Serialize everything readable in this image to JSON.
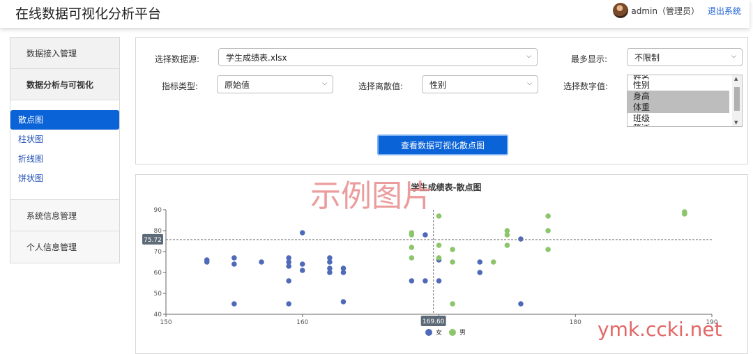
{
  "header": {
    "title": "在线数据可视化分析平台",
    "user_name": "admin（管理员）",
    "logout_label": "退出系统"
  },
  "sidebar": {
    "section_data_access": "数据接入管理",
    "section_analysis": "数据分析与可视化",
    "items": [
      {
        "label": "散点图",
        "active": true
      },
      {
        "label": "柱状图",
        "active": false
      },
      {
        "label": "折线图",
        "active": false
      },
      {
        "label": "饼状图",
        "active": false
      }
    ],
    "section_system": "系统信息管理",
    "section_personal": "个人信息管理"
  },
  "form": {
    "datasource_label": "选择数据源:",
    "datasource_value": "学生成绩表.xlsx",
    "max_display_label": "最多显示:",
    "max_display_value": "不限制",
    "indicator_label": "指标类型:",
    "indicator_value": "原始值",
    "discrete_label": "选择离散值:",
    "discrete_value": "性别",
    "numeric_label": "选择数字值:",
    "numeric_options": [
      {
        "label": "姓名",
        "selected": false,
        "cut": true
      },
      {
        "label": "性别",
        "selected": false
      },
      {
        "label": "身高",
        "selected": true
      },
      {
        "label": "体重",
        "selected": true
      },
      {
        "label": "班级",
        "selected": false
      },
      {
        "label": "数学",
        "selected": false,
        "cut": true
      }
    ],
    "view_button_label": "查看数据可视化散点图"
  },
  "watermarks": {
    "center": "示例图片",
    "corner": "ymk.ccki.net"
  },
  "chart_data": {
    "type": "scatter",
    "title": "学生成绩表-散点图",
    "xlim": [
      150,
      190
    ],
    "ylim": [
      40,
      90
    ],
    "xticks": [
      150,
      160,
      170,
      180,
      190
    ],
    "yticks": [
      40,
      50,
      60,
      70,
      80,
      90
    ],
    "legend_position": "bottom-center",
    "crosshair": {
      "x": 169.6,
      "y": 75.72,
      "x_label": "169.60",
      "y_label": "75.72"
    },
    "series": [
      {
        "name": "女",
        "color": "#4e6ab8",
        "points": [
          [
            153,
            66
          ],
          [
            153,
            65
          ],
          [
            155,
            67
          ],
          [
            155,
            64
          ],
          [
            155,
            45
          ],
          [
            157,
            65
          ],
          [
            159,
            67
          ],
          [
            159,
            65
          ],
          [
            159,
            63
          ],
          [
            159,
            56
          ],
          [
            159,
            45
          ],
          [
            160,
            64
          ],
          [
            160,
            61
          ],
          [
            160,
            79
          ],
          [
            162,
            67
          ],
          [
            162,
            65
          ],
          [
            162,
            62
          ],
          [
            162,
            60
          ],
          [
            163,
            62
          ],
          [
            163,
            60
          ],
          [
            163,
            46
          ],
          [
            168,
            56
          ],
          [
            169,
            56
          ],
          [
            169,
            78
          ],
          [
            170,
            66
          ],
          [
            170,
            56
          ],
          [
            173,
            65
          ],
          [
            173,
            60
          ],
          [
            176,
            76
          ],
          [
            176,
            45
          ]
        ]
      },
      {
        "name": "男",
        "color": "#8cc56a",
        "points": [
          [
            168,
            79
          ],
          [
            168,
            78
          ],
          [
            168,
            72
          ],
          [
            168,
            67
          ],
          [
            170,
            87
          ],
          [
            170,
            73
          ],
          [
            170,
            67
          ],
          [
            171,
            71
          ],
          [
            171,
            65
          ],
          [
            171,
            45
          ],
          [
            174,
            65
          ],
          [
            175,
            80
          ],
          [
            175,
            78
          ],
          [
            175,
            73
          ],
          [
            178,
            87
          ],
          [
            178,
            80
          ],
          [
            178,
            71
          ],
          [
            188,
            89
          ],
          [
            188,
            88
          ]
        ]
      }
    ]
  }
}
